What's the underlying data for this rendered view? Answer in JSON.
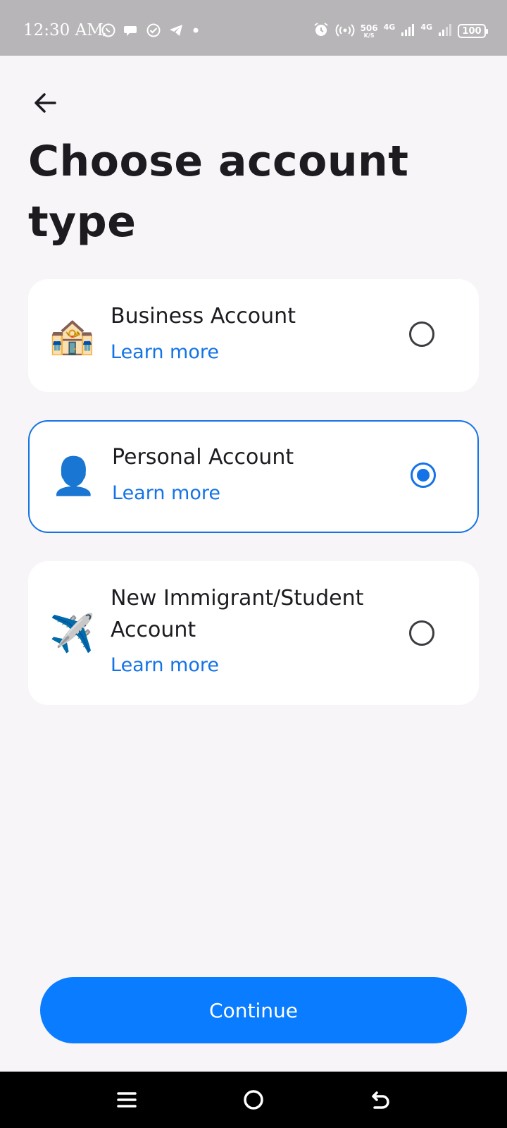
{
  "status_bar": {
    "time": "12:30 AM",
    "speed_value": "506",
    "speed_unit": "K/S",
    "network1": "4G",
    "network2": "4G",
    "battery": "100"
  },
  "page": {
    "title": "Choose account type"
  },
  "options": [
    {
      "emoji": "🏤",
      "label": "Business Account",
      "link": "Learn more",
      "selected": false
    },
    {
      "emoji": "👤",
      "label": "Personal Account",
      "link": "Learn more",
      "selected": true
    },
    {
      "emoji": "✈️",
      "label": "New Immigrant/Student Account",
      "link": "Learn more",
      "selected": false
    }
  ],
  "actions": {
    "continue_label": "Continue"
  },
  "colors": {
    "accent": "#0a7cff",
    "link": "#1473e6",
    "background": "#f7f5f7",
    "card": "#ffffff"
  }
}
